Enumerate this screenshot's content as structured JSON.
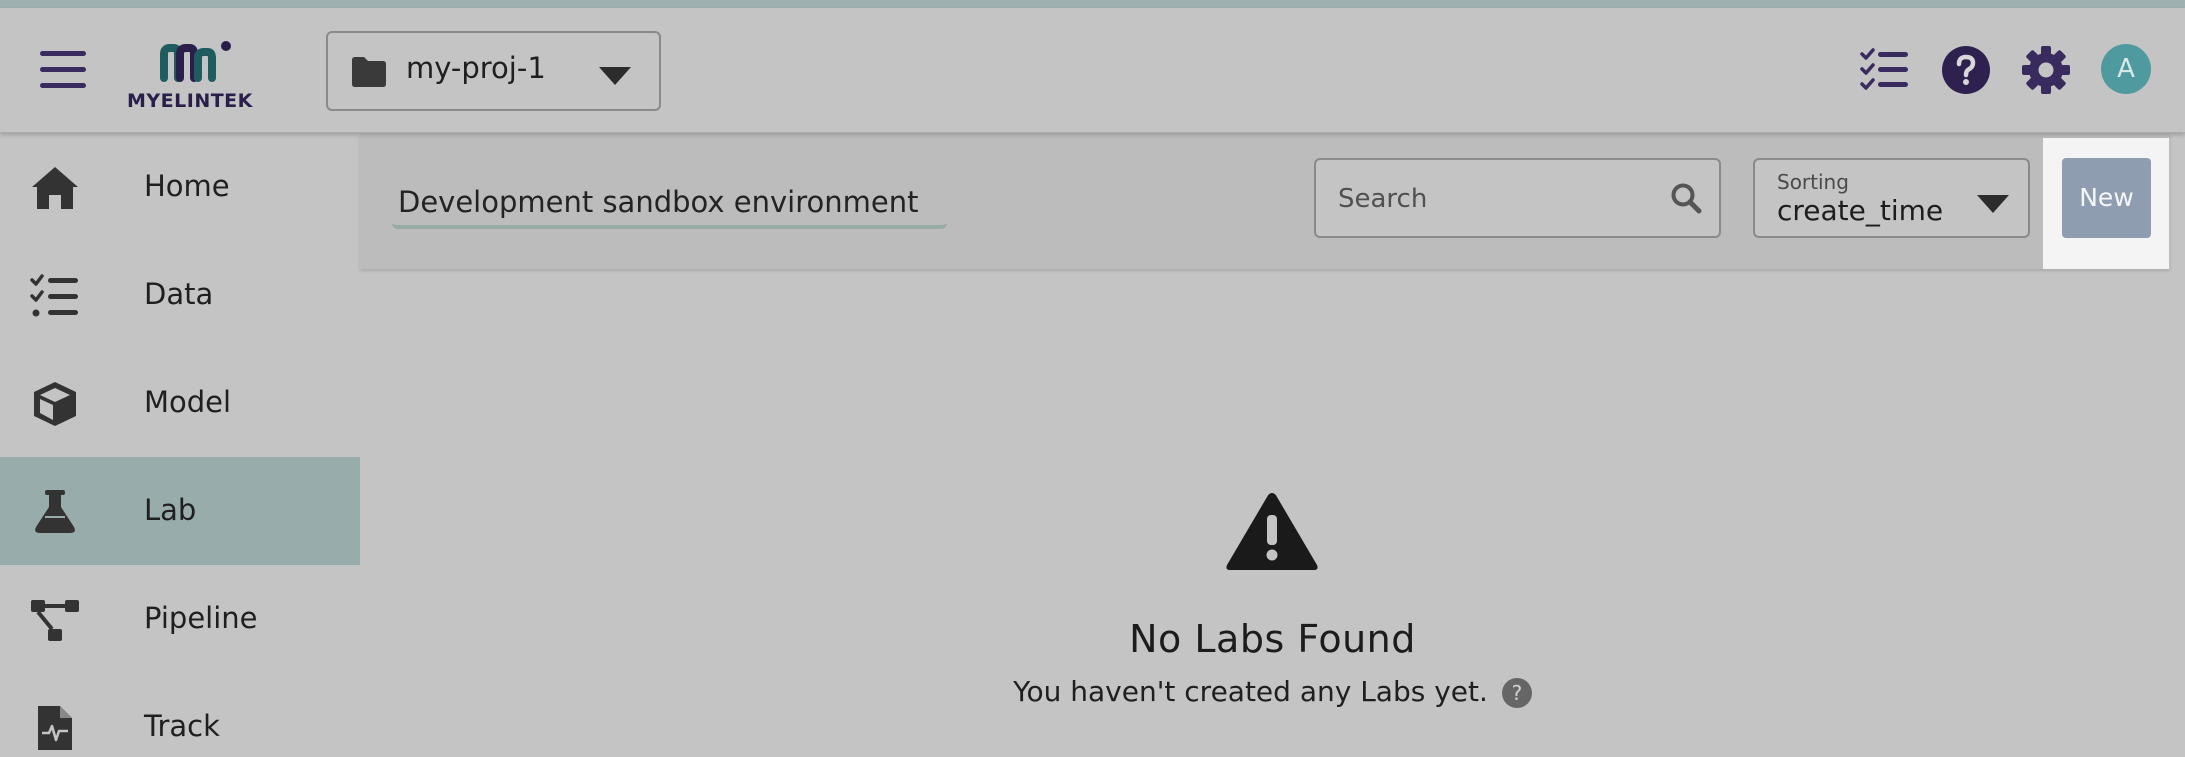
{
  "app": {
    "brand": "MyelinTek",
    "colors": {
      "brand_purple": "#3a2b5e",
      "brand_teal": "#1f5c60",
      "active_nav": "#98acac",
      "avatar": "#4f9a9e",
      "new_button": "#8f9db0"
    }
  },
  "header": {
    "project": "my-proj-1",
    "icons": [
      "checklist-icon",
      "help-icon",
      "settings-icon"
    ],
    "avatar_initial": "A"
  },
  "sidebar": {
    "items": [
      {
        "label": "Home",
        "icon": "home-icon",
        "active": false
      },
      {
        "label": "Data",
        "icon": "data-list-icon",
        "active": false
      },
      {
        "label": "Model",
        "icon": "cube-icon",
        "active": false
      },
      {
        "label": "Lab",
        "icon": "flask-icon",
        "active": true
      },
      {
        "label": "Pipeline",
        "icon": "pipeline-icon",
        "active": false
      },
      {
        "label": "Track",
        "icon": "track-file-icon",
        "active": false
      }
    ]
  },
  "toolbar": {
    "environment": "Development sandbox environment",
    "search_placeholder": "Search",
    "sorting_label": "Sorting",
    "sorting_value": "create_time",
    "new_label": "New"
  },
  "empty_state": {
    "icon": "warning-icon",
    "title": "No Labs Found",
    "subtitle": "You haven't created any Labs yet.",
    "help_glyph": "?"
  }
}
